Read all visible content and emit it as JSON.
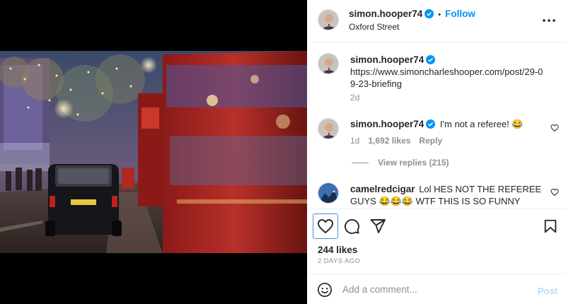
{
  "post_author": {
    "username": "simon.hooper74",
    "follow_label": "Follow",
    "separator": "•",
    "location": "Oxford Street"
  },
  "caption": {
    "username": "simon.hooper74",
    "text": "https://www.simoncharleshooper.com/post/29-09-23-briefing",
    "time": "2d"
  },
  "comments": [
    {
      "username": "simon.hooper74",
      "text": "I'm not a referee! 😂",
      "time": "1d",
      "likes": "1,692 likes",
      "reply_label": "Reply",
      "view_replies": "View replies (215)"
    },
    {
      "username": "camelredcigar",
      "text": "Lol HES NOT THE REFEREE GUYS 😂😂😂 WTF THIS IS SO FUNNY"
    }
  ],
  "actions": {
    "likes": "244 likes",
    "posted_ago": "2 DAYS AGO"
  },
  "add_comment": {
    "placeholder": "Add a comment...",
    "post_label": "Post"
  },
  "icons": [
    "verified-badge-icon",
    "more-options-icon",
    "heart-icon",
    "comment-icon",
    "share-icon",
    "bookmark-icon",
    "emoji-icon"
  ],
  "colors": {
    "accent": "#0095f6",
    "muted": "#8e8e8e",
    "post_disabled": "#b2dffc"
  }
}
